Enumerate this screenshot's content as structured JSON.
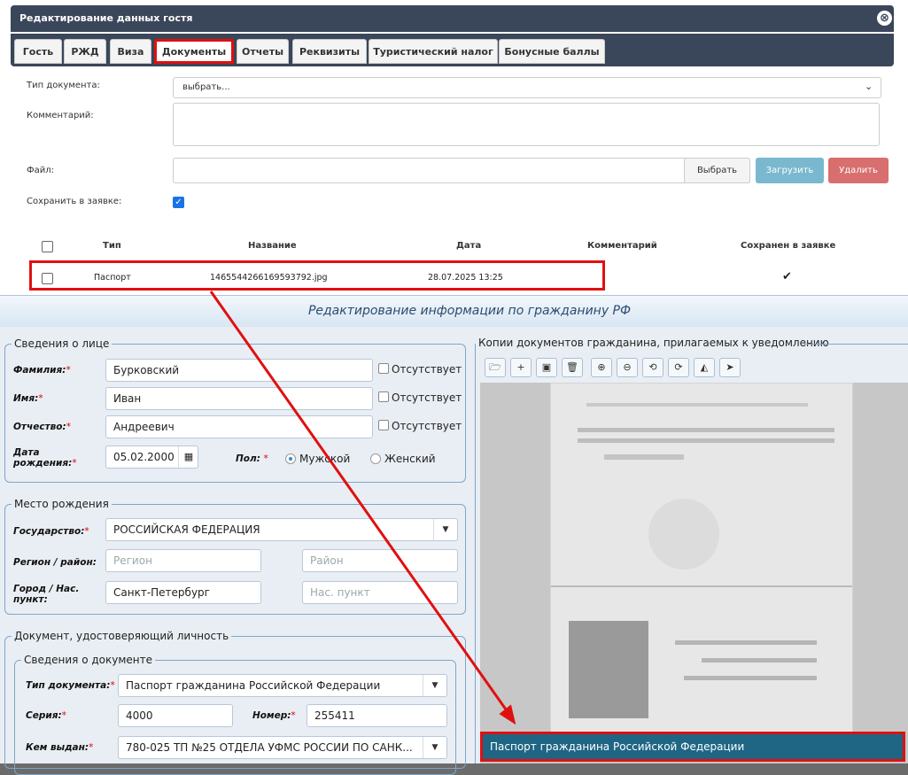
{
  "dialog": {
    "title": "Редактирование данных гостя",
    "close_icon": "⊗",
    "tabs": [
      "Гость",
      "РЖД",
      "Виза",
      "Документы",
      "Отчеты",
      "Реквизиты",
      "Туристический налог",
      "Бонусные баллы"
    ],
    "active_tab": "Документы",
    "doc_type_label": "Тип документа:",
    "doc_type_value": "выбрать...",
    "comment_label": "Комментарий:",
    "file_label": "Файл:",
    "choose_button": "Выбрать",
    "upload_button": "Загрузить",
    "delete_button": "Удалить",
    "save_in_request_label": "Сохранить в заявке:",
    "table": {
      "headers": [
        "Тип",
        "Название",
        "Дата",
        "Комментарий",
        "Сохранен в заявке"
      ],
      "rows": [
        {
          "type": "Паспорт",
          "name": "1465544266169593792.jpg",
          "date": "28.07.2025 13:25",
          "comment": "",
          "saved": "✔"
        }
      ]
    }
  },
  "window": {
    "title": "Редактирование информации по гражданину РФ",
    "person": {
      "legend": "Сведения о лице",
      "surname_label": "Фамилия:",
      "surname": "Бурковский",
      "name_label": "Имя:",
      "name": "Иван",
      "patronymic_label": "Отчество:",
      "patronymic": "Андреевич",
      "absent_label": "Отсутствует",
      "birthdate_label_1": "Дата",
      "birthdate_label_2": "рождения:",
      "birthdate": "05.02.2000",
      "sex_label": "Пол:",
      "male": "Мужской",
      "female": "Женский"
    },
    "birthplace": {
      "legend": "Место рождения",
      "country_label": "Государство:",
      "country": "РОССИЙСКАЯ ФЕДЕРАЦИЯ",
      "region_label": "Регион / район:",
      "region_placeholder": "Регион",
      "district_placeholder": "Район",
      "city_label_1": "Город / Нас.",
      "city_label_2": "пункт:",
      "city": "Санкт-Петербург",
      "settlement_placeholder": "Нас. пункт"
    },
    "identity": {
      "legend": "Документ, удостоверяющий личность",
      "sub_legend": "Сведения о документе",
      "doc_type_label": "Тип документа:",
      "doc_type": "Паспорт гражданина Российской Федерации",
      "series_label": "Серия:",
      "series": "4000",
      "number_label": "Номер:",
      "number": "255411",
      "issued_label": "Кем выдан:",
      "issued_by": "780-025 ТП №25 ОТДЕЛА УФМС РОССИИ ПО САНК..."
    },
    "copies": {
      "legend": "Копии документов гражданина, прилагаемых к уведомлению",
      "toolbar_icons": [
        "folder-open-icon",
        "add-icon",
        "save-icon",
        "trash-icon",
        "zoom-in-icon",
        "zoom-out-icon",
        "rotate-left-icon",
        "rotate-right-icon",
        "flip-icon",
        "send-icon"
      ],
      "caption": "Паспорт гражданина Российской Федерации"
    }
  },
  "colors": {
    "dialog_bar": "#3a4659",
    "highlight": "#e01010",
    "upload": "#7ab8cf",
    "delete": "#d86e6e",
    "caption_bg": "#1f6584"
  }
}
